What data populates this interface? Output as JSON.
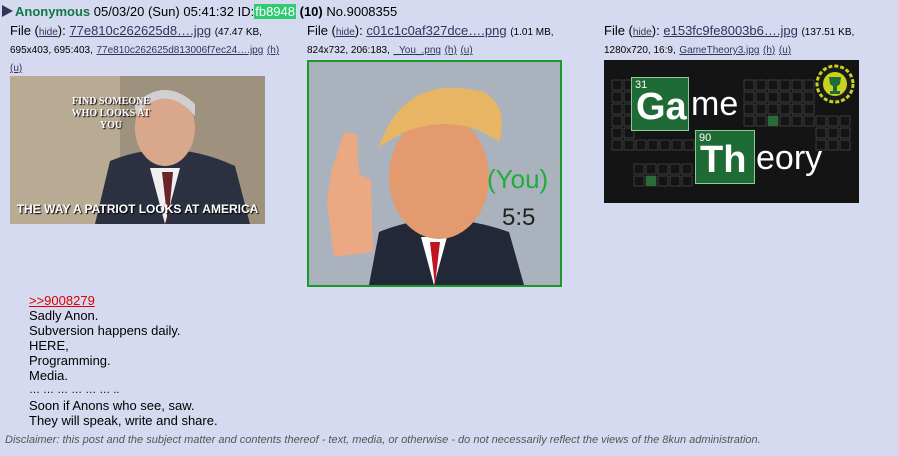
{
  "post": {
    "name": "Anonymous",
    "date": "05/03/20 (Sun) 05:41:32",
    "id_label": "ID:",
    "id_value": "fb8948",
    "reply_count": "(10)",
    "post_no": "No.9008355"
  },
  "files": [
    {
      "file_label": "File (",
      "hide_label": "hide",
      "close_paren": "):",
      "filename": "77e810c262625d8….jpg",
      "meta_line1": "(47.47 KB,",
      "meta_line2": "695x403, 695:403,",
      "orig_name": "77e810c262625d813006f7ec24….jpg",
      "h_label": "(h)",
      "u_label": "(u)",
      "thumb_caption_top": "FIND SOMEONE WHO LOOKS AT YOU",
      "thumb_caption_bottom": "THE WAY A PATRIOT LOOKS AT AMERICA"
    },
    {
      "file_label": "File (",
      "hide_label": "hide",
      "close_paren": "):",
      "filename": "c01c1c0af327dce….png",
      "meta_line1": "(1.01 MB,",
      "meta_line2": "824x732, 206:183,",
      "orig_name": "_You_.png",
      "h_label": "(h)",
      "u_label": "(u)",
      "thumb_you": "(You)",
      "thumb_score": "5:5"
    },
    {
      "file_label": "File (",
      "hide_label": "hide",
      "close_paren": "):",
      "filename": "e153fc9fe8003b6….jpg",
      "meta_line1": "(137.51 KB,",
      "meta_line2": "1280x720, 16:9,",
      "orig_name": "GameTheory3.jpg",
      "h_label": "(h)",
      "u_label": "(u)",
      "thumb_num1": "31",
      "thumb_ga": "Ga",
      "thumb_me": "me",
      "thumb_num2": "90",
      "thumb_th": "Th",
      "thumb_eory": "eory"
    }
  ],
  "body": {
    "quote": ">>9008279",
    "lines": [
      "Sadly Anon.",
      "Subversion happens daily.",
      "HERE,",
      "Programming.",
      "Media.",
      "… … … … … … ..",
      "Soon if Anons who see, saw.",
      "They will speak, write and share."
    ]
  },
  "disclaimer": "Disclaimer: this post and the subject matter and contents thereof - text, media, or otherwise - do not necessarily reflect the views of the 8kun administration.",
  "colors": {
    "background": "#d6daf0",
    "name": "#117743",
    "id_highlight": "#2ecc71",
    "link": "#34345c",
    "quote": "#dd0000",
    "green_border": "#1a9a2a"
  }
}
